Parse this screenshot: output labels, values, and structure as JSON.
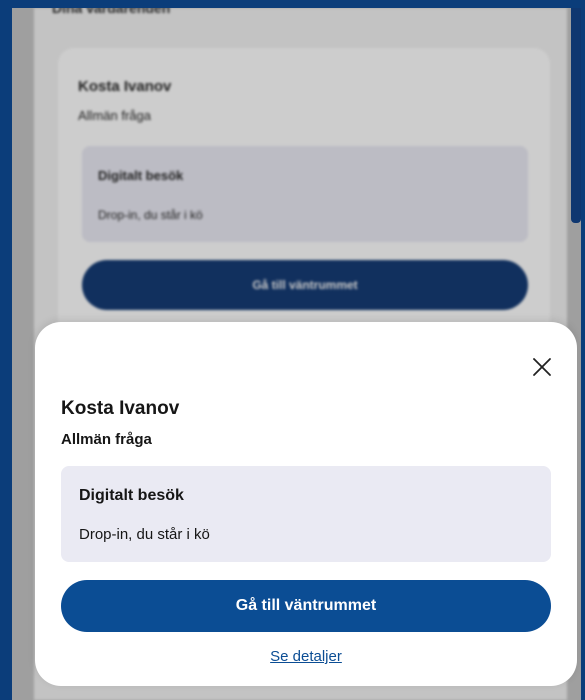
{
  "background": {
    "top_title": "Dina vårdärenden",
    "card": {
      "name": "Kosta Ivanov",
      "subtitle": "Allmän fråga",
      "box_title": "Digitalt besök",
      "box_text": "Drop-in, du står i kö",
      "button_label": "Gå till väntrummet"
    }
  },
  "sheet": {
    "close_icon": "close-icon",
    "name": "Kosta Ivanov",
    "subtitle": "Allmän fråga",
    "info": {
      "title": "Digitalt besök",
      "text": "Drop-in, du står i kö"
    },
    "primary_button": "Gå till väntrummet",
    "details_link": "Se detaljer"
  },
  "colors": {
    "frame_border": "#0b3d7a",
    "primary": "#0b4d94",
    "info_box": "#eaeaf3"
  }
}
